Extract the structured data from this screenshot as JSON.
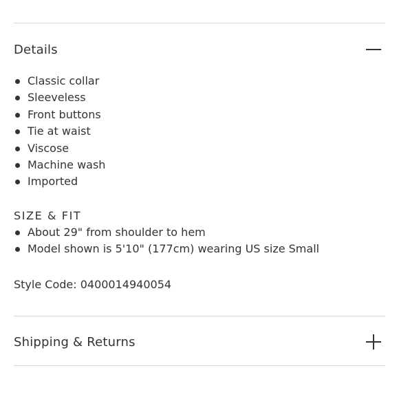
{
  "details": {
    "title": "Details",
    "toggle_icon": "minus-icon",
    "items": [
      "Classic collar",
      "Sleeveless",
      "Front buttons",
      "Tie at waist",
      "Viscose",
      "Machine wash",
      "Imported"
    ]
  },
  "size_fit": {
    "heading": "SIZE & FIT",
    "items": [
      "About 29\" from shoulder to hem",
      "Model shown is 5'10\" (177cm) wearing US size Small"
    ]
  },
  "style_code": "Style Code: 0400014940054",
  "shipping": {
    "title": "Shipping & Returns",
    "toggle_icon": "plus-icon"
  },
  "colors": {
    "text": "#333333",
    "divider": "#d9d9d9",
    "background": "#ffffff"
  }
}
